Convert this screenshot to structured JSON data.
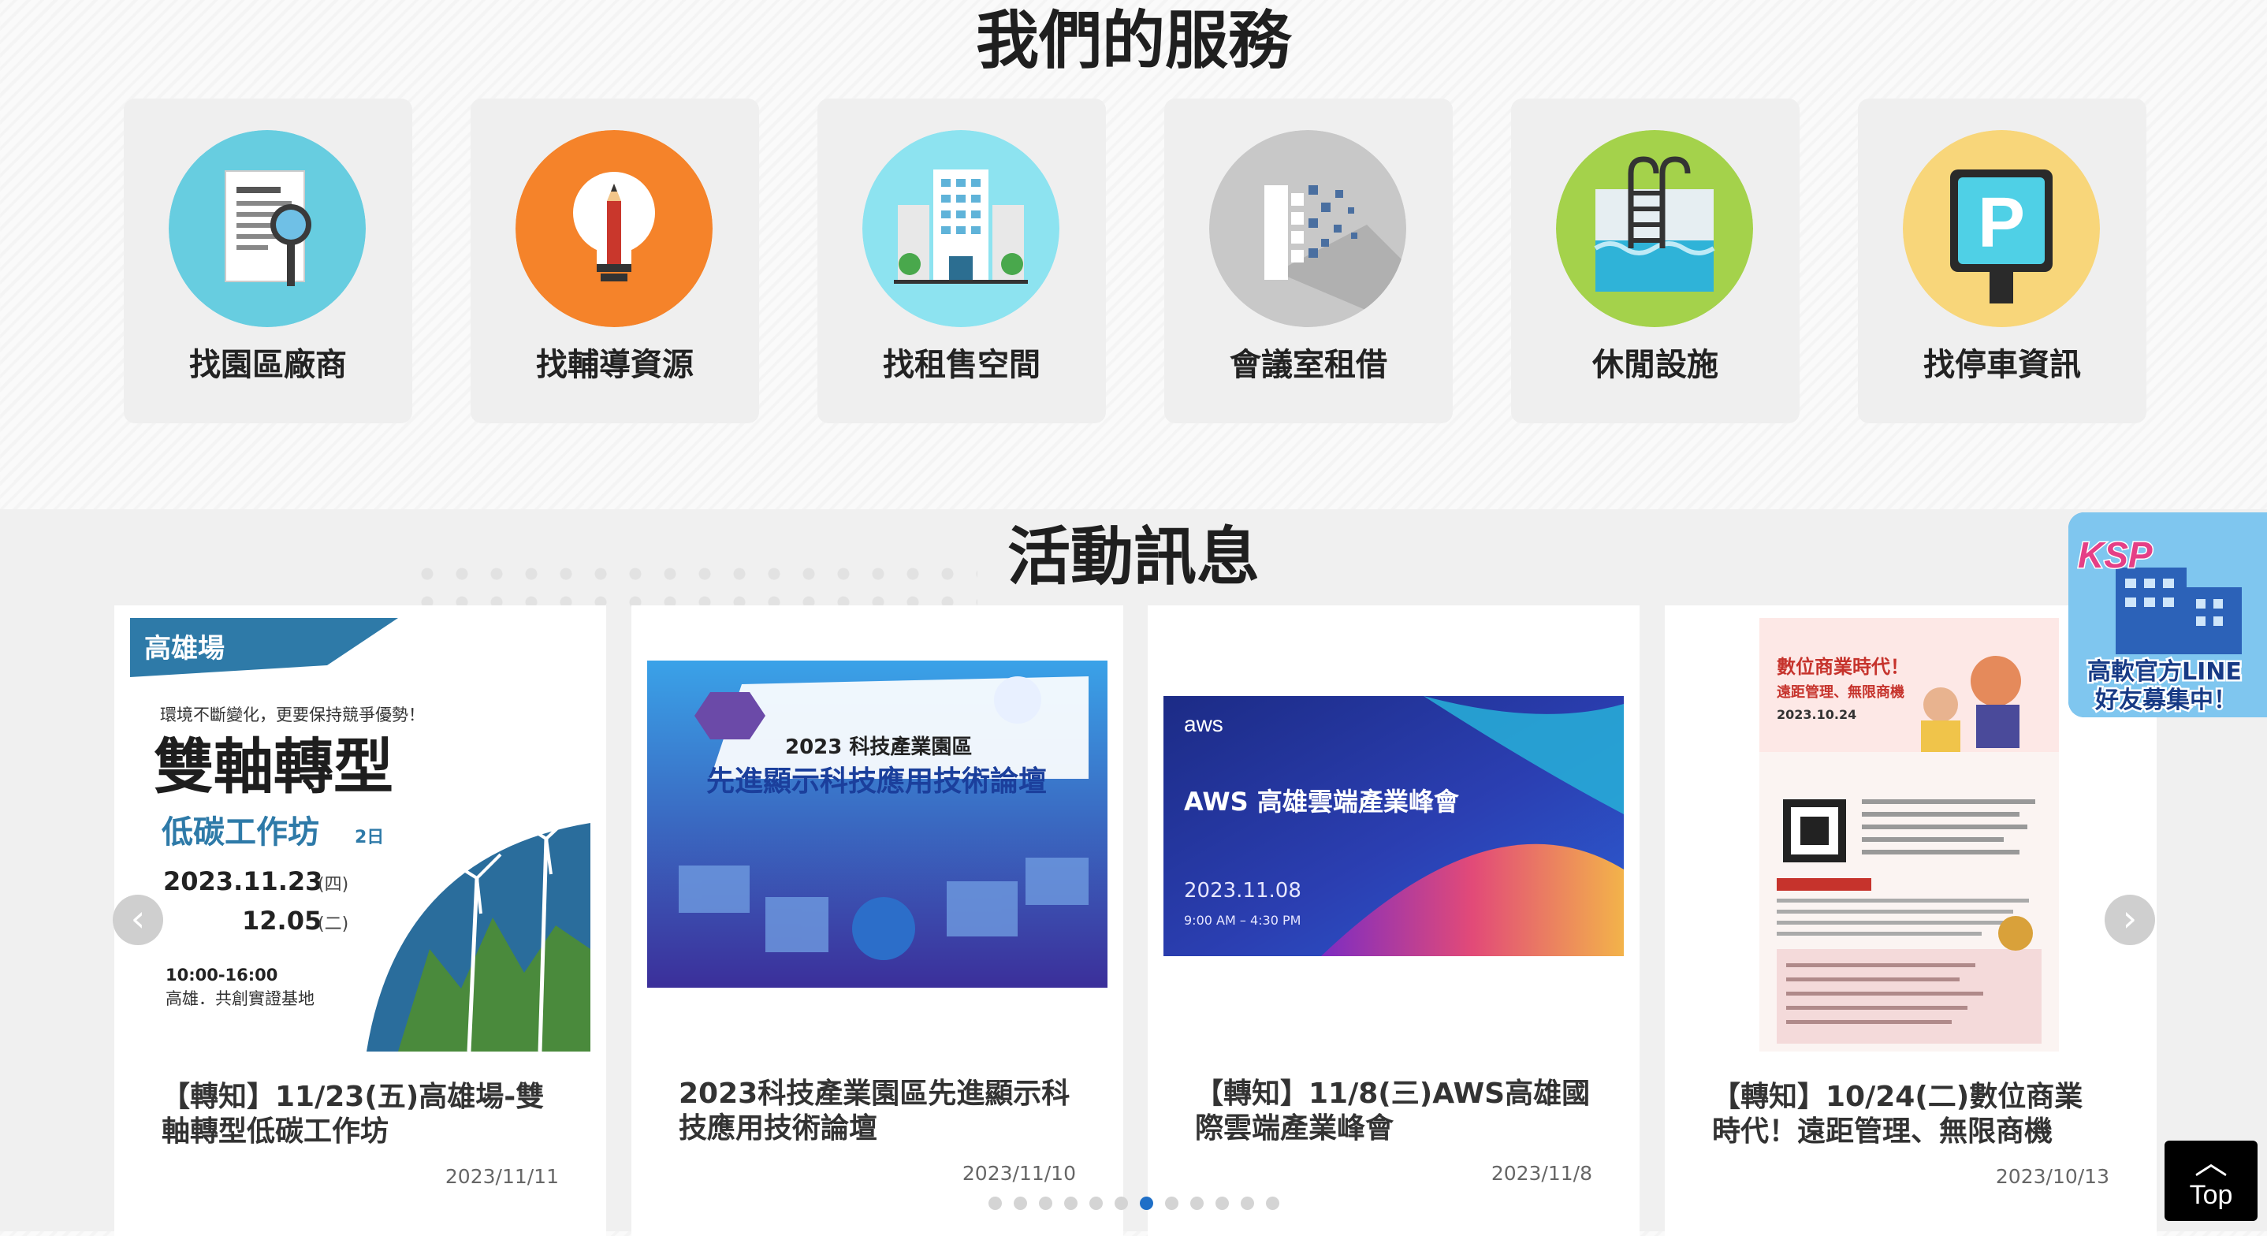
{
  "services": {
    "title": "我們的服務",
    "items": [
      {
        "label": "找園區廠商",
        "icon": "document-magnifier-icon",
        "color": "#67cde0"
      },
      {
        "label": "找輔導資源",
        "icon": "lightbulb-pencil-icon",
        "color": "#f5832a"
      },
      {
        "label": "找租售空間",
        "icon": "building-icon",
        "color": "#8de3f0"
      },
      {
        "label": "會議室租借",
        "icon": "pixel-document-icon",
        "color": "#c8c8c8"
      },
      {
        "label": "休閒設施",
        "icon": "swimming-pool-icon",
        "color": "#a4d24b"
      },
      {
        "label": "找停車資訊",
        "icon": "parking-sign-icon",
        "color": "#f8d67a"
      }
    ]
  },
  "events": {
    "title": "活動訊息",
    "items": [
      {
        "title": "【轉知】11/23(五)高雄場-雙軸轉型低碳工作坊",
        "date": "2023/11/11",
        "poster": {
          "city": "高雄場",
          "tagline": "環境不斷變化，更要保持競爭優勢！",
          "headline": "雙軸轉型",
          "sub": "低碳工作坊",
          "days": "2日",
          "date1": "2023.11.23",
          "dow1": "(四)",
          "date2": "12.05",
          "dow2": "(二)",
          "time": "10:00-16:00",
          "venue": "高雄．共創實證基地"
        }
      },
      {
        "title": "2023科技產業園區先進顯示科技應用技術論壇",
        "date": "2023/11/10",
        "poster": {
          "line1": "2023 科技產業園區",
          "line2": "先進顯示科技應用技術論壇"
        }
      },
      {
        "title": "【轉知】11/8(三)AWS高雄國際雲端產業峰會",
        "date": "2023/11/8",
        "poster": {
          "brand": "aws",
          "headline": "AWS 高雄雲端產業峰會",
          "date": "2023.11.08",
          "time": "9:00 AM – 4:30 PM"
        }
      },
      {
        "title": "【轉知】10/24(二)數位商業時代！遠距管理、無限商機",
        "date": "2023/10/13",
        "poster": {
          "headline": "數位商業時代！",
          "sub": "遠距管理、無限商機",
          "date": "2023.10.24"
        }
      }
    ],
    "pager": {
      "count": 12,
      "active": 6
    }
  },
  "line_badge": {
    "brand": "KSP",
    "text1": "高軟官方LINE",
    "text2": "好友募集中！"
  },
  "top_button": {
    "label": "Top"
  },
  "colors": {
    "accent": "#1f6fc7",
    "card_bg": "#efefef"
  }
}
